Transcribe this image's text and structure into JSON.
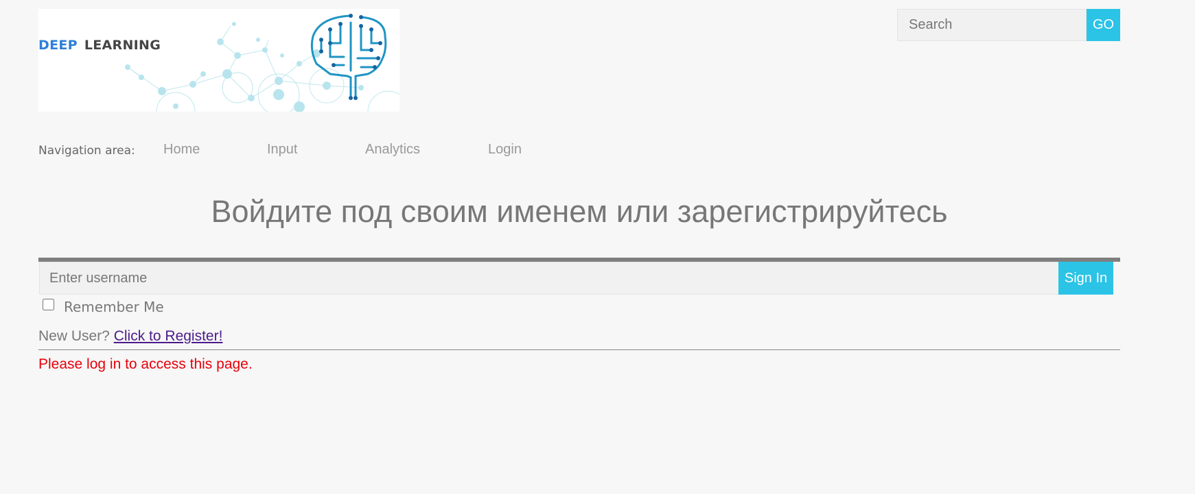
{
  "logo": {
    "word1": "DEEP",
    "word2": "LEARNING",
    "icon": "brain-circuit-icon"
  },
  "search": {
    "placeholder": "Search",
    "button_label": "GO"
  },
  "nav": {
    "label": "Navigation area:",
    "items": [
      {
        "label": "Home"
      },
      {
        "label": "Input"
      },
      {
        "label": "Analytics"
      },
      {
        "label": "Login"
      }
    ]
  },
  "heading": "Войдите под своим именем или зарегистрируйтесь",
  "login_form": {
    "username_placeholder": "Enter username",
    "signin_label": "Sign In",
    "remember_label": "Remember Me",
    "new_user_text": "New User?",
    "register_link": "Click to Register!"
  },
  "message": "Please log in to access this page.",
  "colors": {
    "accent": "#2bc3e6",
    "error": "#e8000b",
    "link_visited": "#4b1a8a",
    "logo_blue": "#2e7fd8"
  }
}
